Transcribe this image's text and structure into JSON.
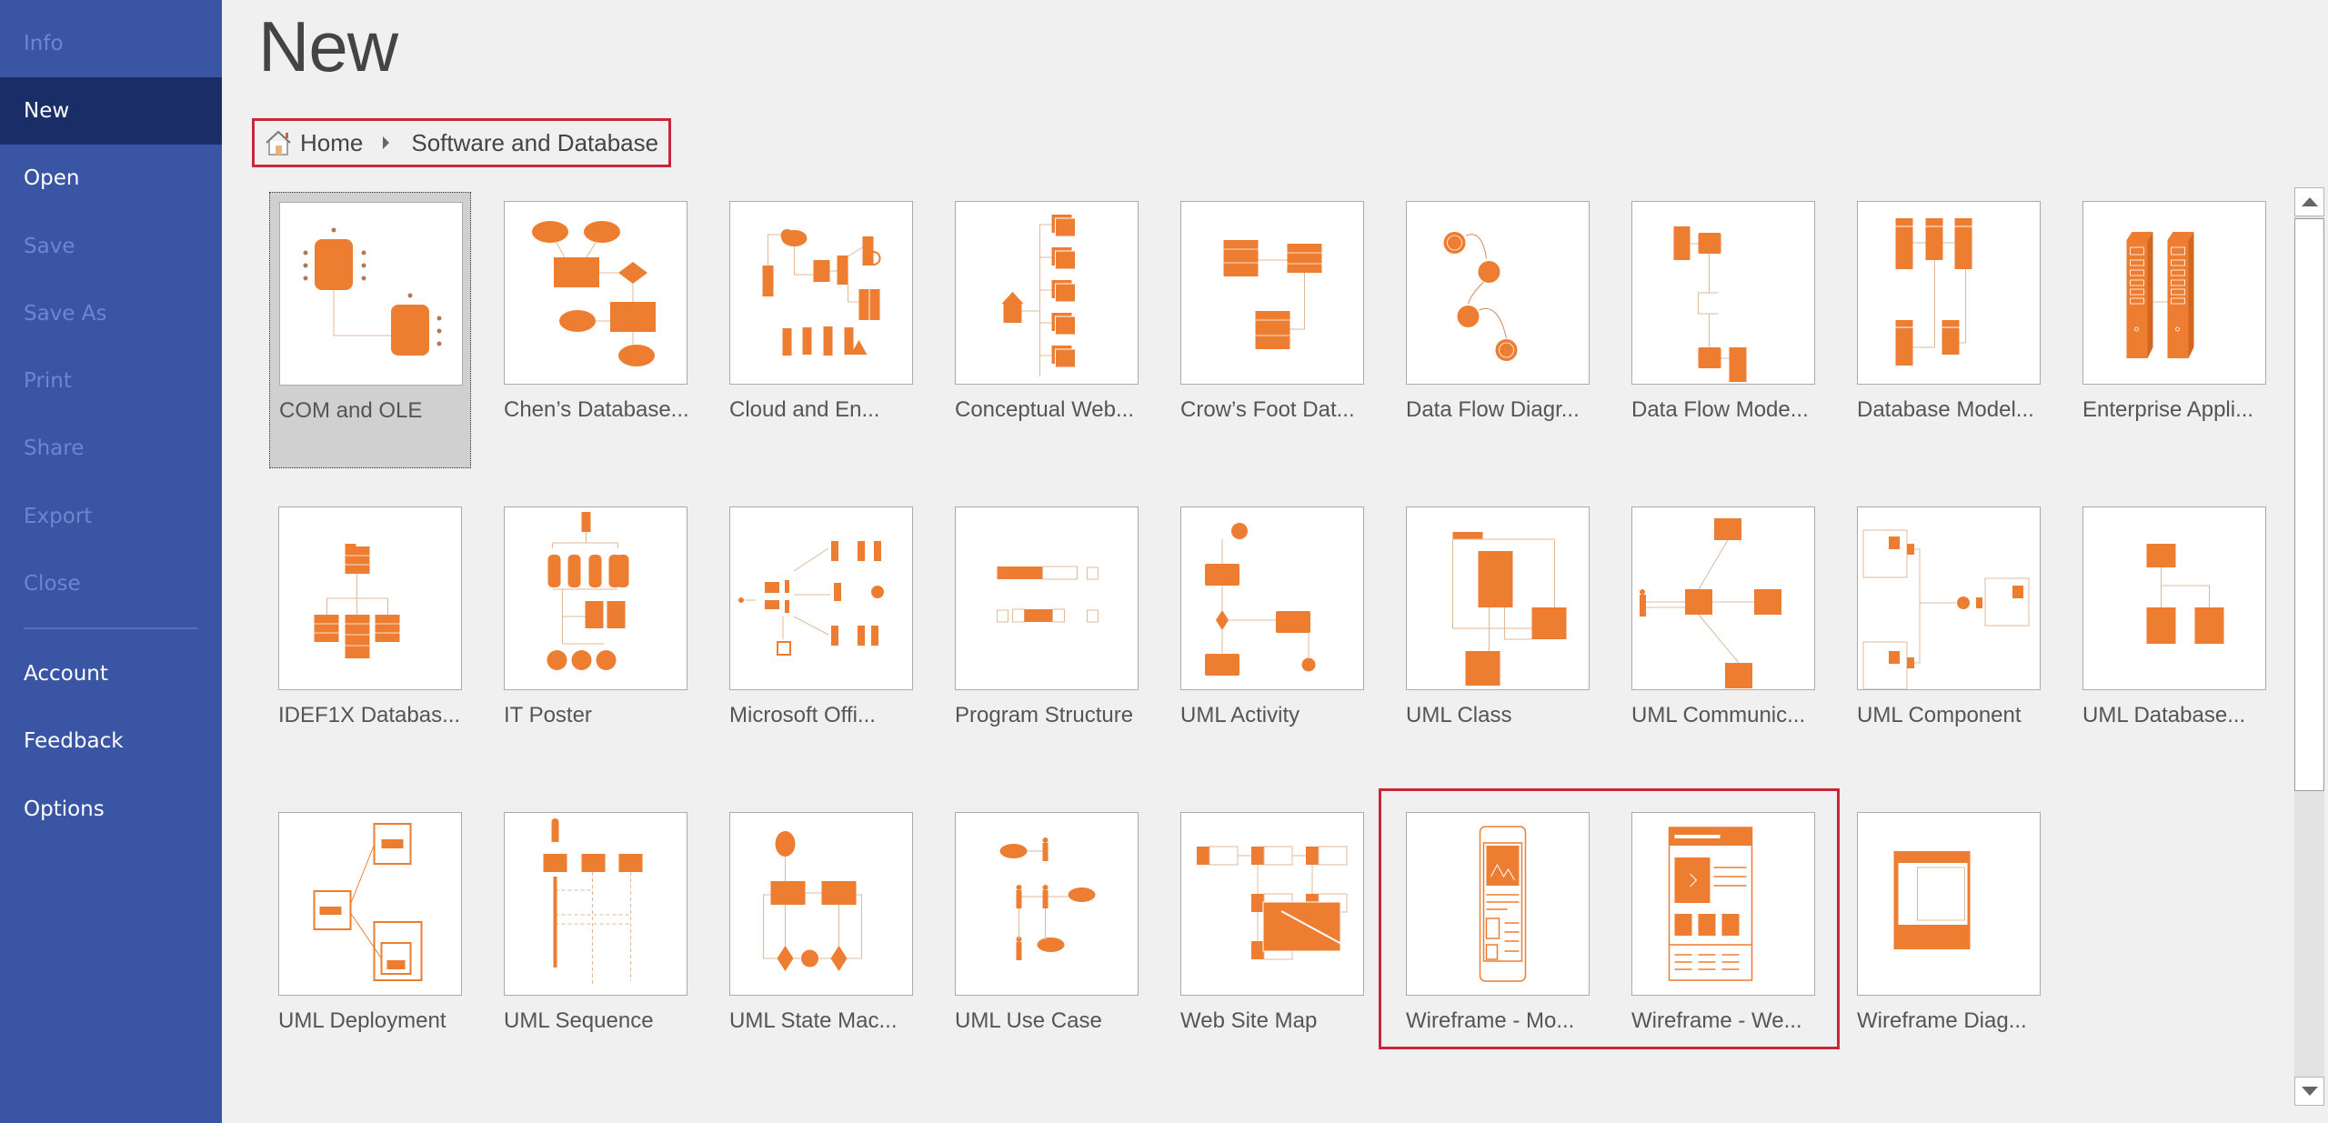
{
  "sidebar": {
    "items": [
      {
        "label": "Info",
        "state": "disabled"
      },
      {
        "label": "New",
        "state": "active"
      },
      {
        "label": "Open",
        "state": "enabled"
      },
      {
        "label": "Save",
        "state": "disabled"
      },
      {
        "label": "Save As",
        "state": "disabled"
      },
      {
        "label": "Print",
        "state": "disabled"
      },
      {
        "label": "Share",
        "state": "disabled"
      },
      {
        "label": "Export",
        "state": "disabled"
      },
      {
        "label": "Close",
        "state": "disabled"
      },
      {
        "label": "Account",
        "state": "enabled"
      },
      {
        "label": "Feedback",
        "state": "enabled"
      },
      {
        "label": "Options",
        "state": "enabled"
      }
    ]
  },
  "main": {
    "title": "New",
    "breadcrumb": {
      "home_icon": "home-icon",
      "home": "Home",
      "separator_icon": "chevron-right-icon",
      "current": "Software and Database"
    },
    "templates": [
      {
        "label": "COM and OLE",
        "thumb": "com-ole",
        "selected": true
      },
      {
        "label": "Chen’s Database...",
        "thumb": "chen"
      },
      {
        "label": "Cloud and En...",
        "thumb": "cloud"
      },
      {
        "label": "Conceptual Web...",
        "thumb": "conceptual"
      },
      {
        "label": "Crow’s Foot Dat...",
        "thumb": "crowsfoot"
      },
      {
        "label": "Data Flow Diagr...",
        "thumb": "dfd"
      },
      {
        "label": "Data Flow Mode...",
        "thumb": "dfm"
      },
      {
        "label": "Database Model...",
        "thumb": "dbmodel"
      },
      {
        "label": "Enterprise Appli...",
        "thumb": "enterprise"
      },
      {
        "label": "IDEF1X Databas...",
        "thumb": "idef1x"
      },
      {
        "label": "IT Poster",
        "thumb": "itposter"
      },
      {
        "label": "Microsoft Offi...",
        "thumb": "msoffice"
      },
      {
        "label": "Program Structure",
        "thumb": "program"
      },
      {
        "label": "UML Activity",
        "thumb": "umlactivity"
      },
      {
        "label": "UML Class",
        "thumb": "umlclass"
      },
      {
        "label": "UML Communic...",
        "thumb": "umlcomm"
      },
      {
        "label": "UML Component",
        "thumb": "umlcomponent"
      },
      {
        "label": "UML Database...",
        "thumb": "umldb"
      },
      {
        "label": "UML Deployment",
        "thumb": "umldeploy"
      },
      {
        "label": "UML Sequence",
        "thumb": "umlseq"
      },
      {
        "label": "UML State Mac...",
        "thumb": "umlstate"
      },
      {
        "label": "UML Use Case",
        "thumb": "umlusecase"
      },
      {
        "label": "Web Site Map",
        "thumb": "sitemap"
      },
      {
        "label": "Wireframe - Mo...",
        "thumb": "wfmobile",
        "highlighted": true
      },
      {
        "label": "Wireframe - We...",
        "thumb": "wfweb",
        "highlighted": true
      },
      {
        "label": "Wireframe Diag...",
        "thumb": "wfdiag"
      }
    ]
  },
  "colors": {
    "sidebar_bg": "#3955a3",
    "sidebar_active": "#1b2d66",
    "accent_orange": "#ed7d31",
    "highlight_red": "#c8273a"
  },
  "scrollbar": {
    "up_icon": "scroll-up-arrow-icon",
    "down_icon": "scroll-down-arrow-icon"
  }
}
